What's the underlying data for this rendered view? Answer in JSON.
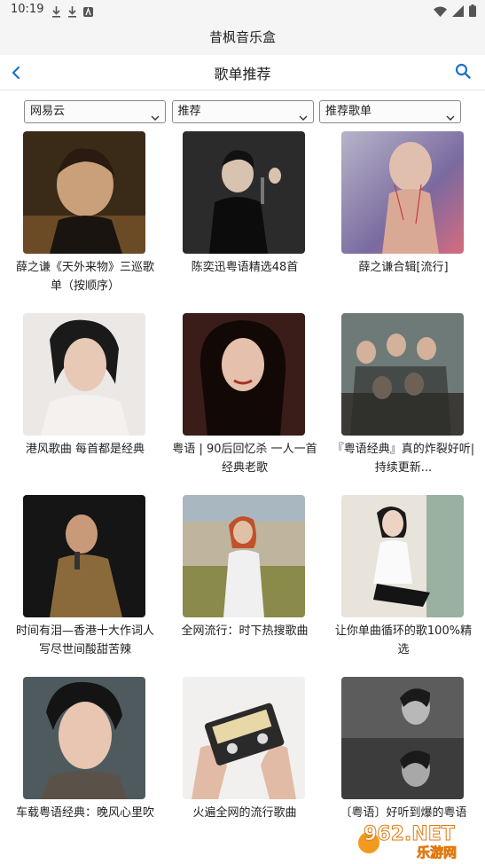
{
  "status": {
    "time": "10:19"
  },
  "app": {
    "title": "昔枫音乐盒"
  },
  "nav": {
    "title": "歌单推荐"
  },
  "filters": [
    {
      "value": "网易云"
    },
    {
      "value": "推荐"
    },
    {
      "value": "推荐歌单"
    }
  ],
  "playlists": [
    {
      "title": "薛之谦《天外来物》三巡歌单（按顺序）"
    },
    {
      "title": "陈奕迅粤语精选48首"
    },
    {
      "title": "薛之谦合辑[流行]"
    },
    {
      "title": "港风歌曲 每首都是经典"
    },
    {
      "title": "粤语 | 90后回忆杀 一人一首经典老歌"
    },
    {
      "title": "『粤语经典』真的炸裂好听|持续更新..."
    },
    {
      "title": "时间有泪—香港十大作词人写尽世间酸甜苦辣"
    },
    {
      "title": "全网流行：时下热搜歌曲"
    },
    {
      "title": "让你单曲循环的歌100%精选"
    },
    {
      "title": "车载粤语经典：晚风心里吹"
    },
    {
      "title": "火遍全网的流行歌曲"
    },
    {
      "title": "〔粤语〕好听到爆的粤语"
    }
  ],
  "watermark": {
    "text": "962.NET",
    "subtext": "乐游网"
  },
  "colors": {
    "accent": "#1a73c8",
    "background": "#ffffff",
    "bar": "#f5f5f5"
  },
  "icons": {
    "back": "chevron-left-icon",
    "search": "search-icon",
    "caret": "chevron-down-icon"
  }
}
